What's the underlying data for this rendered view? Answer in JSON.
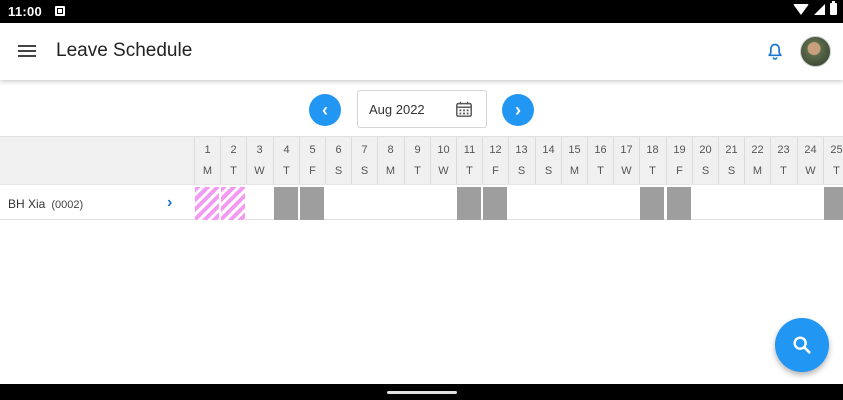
{
  "status_bar": {
    "time": "11:00"
  },
  "app_bar": {
    "title": "Leave Schedule"
  },
  "month_picker": {
    "value": "Aug 2022"
  },
  "calendar": {
    "days": [
      {
        "num": "1",
        "dow": "M",
        "status": "leave"
      },
      {
        "num": "2",
        "dow": "T",
        "status": "leave"
      },
      {
        "num": "3",
        "dow": "W",
        "status": "none"
      },
      {
        "num": "4",
        "dow": "T",
        "status": "weekend"
      },
      {
        "num": "5",
        "dow": "F",
        "status": "weekend"
      },
      {
        "num": "6",
        "dow": "S",
        "status": "none"
      },
      {
        "num": "7",
        "dow": "S",
        "status": "none"
      },
      {
        "num": "8",
        "dow": "M",
        "status": "none"
      },
      {
        "num": "9",
        "dow": "T",
        "status": "none"
      },
      {
        "num": "10",
        "dow": "W",
        "status": "none"
      },
      {
        "num": "11",
        "dow": "T",
        "status": "weekend"
      },
      {
        "num": "12",
        "dow": "F",
        "status": "weekend"
      },
      {
        "num": "13",
        "dow": "S",
        "status": "none"
      },
      {
        "num": "14",
        "dow": "S",
        "status": "none"
      },
      {
        "num": "15",
        "dow": "M",
        "status": "none"
      },
      {
        "num": "16",
        "dow": "T",
        "status": "none"
      },
      {
        "num": "17",
        "dow": "W",
        "status": "none"
      },
      {
        "num": "18",
        "dow": "T",
        "status": "weekend"
      },
      {
        "num": "19",
        "dow": "F",
        "status": "weekend"
      },
      {
        "num": "20",
        "dow": "S",
        "status": "none"
      },
      {
        "num": "21",
        "dow": "S",
        "status": "none"
      },
      {
        "num": "22",
        "dow": "M",
        "status": "none"
      },
      {
        "num": "23",
        "dow": "T",
        "status": "none"
      },
      {
        "num": "24",
        "dow": "W",
        "status": "none"
      },
      {
        "num": "25",
        "dow": "T",
        "status": "weekend"
      }
    ]
  },
  "employees": [
    {
      "name": "BH Xia",
      "id": "(0002)"
    }
  ],
  "colors": {
    "accent": "#2196f3",
    "weekend": "#9e9e9e",
    "leave": "#f39af3"
  }
}
